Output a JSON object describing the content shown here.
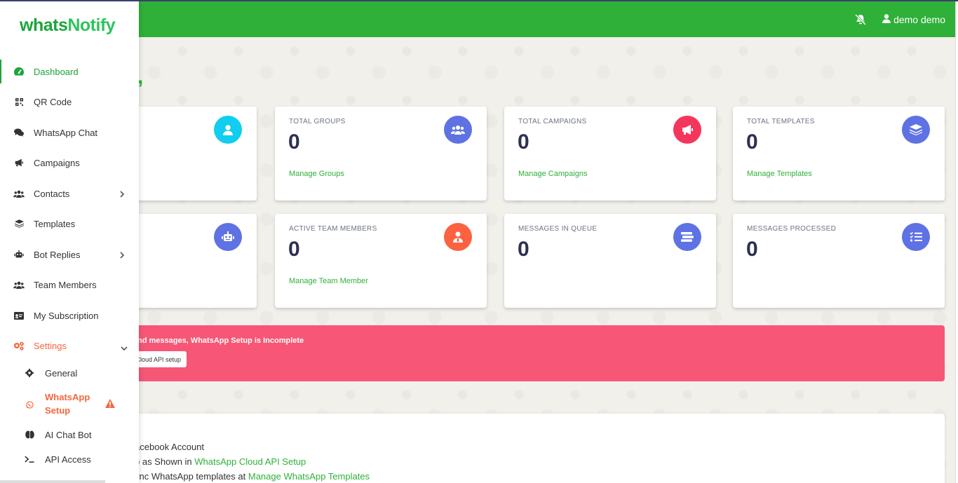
{
  "app": {
    "logo_part1": "whats",
    "logo_part2": "Notify",
    "brand_color": "#2eb039"
  },
  "header": {
    "user_label": "demo demo",
    "icons": [
      "bell-slash-icon",
      "user-icon"
    ]
  },
  "greeting_fragment": ",",
  "sidebar": {
    "items": [
      {
        "label": "Dashboard",
        "icon": "gauge-icon"
      },
      {
        "label": "QR Code",
        "icon": "qrcode-icon"
      },
      {
        "label": "WhatsApp Chat",
        "icon": "comments-icon"
      },
      {
        "label": "Campaigns",
        "icon": "megaphone-icon"
      },
      {
        "label": "Contacts",
        "icon": "users-icon"
      },
      {
        "label": "Templates",
        "icon": "layers-icon"
      },
      {
        "label": "Bot Replies",
        "icon": "robot-icon"
      },
      {
        "label": "Team Members",
        "icon": "users-icon"
      },
      {
        "label": "My Subscription",
        "icon": "id-card-icon"
      },
      {
        "label": "Settings",
        "icon": "cogs-icon"
      }
    ],
    "settings_sub": [
      {
        "label": "General",
        "icon": "gear-icon"
      },
      {
        "label": "WhatsApp Setup",
        "icon": "whatsapp-icon"
      },
      {
        "label": "AI Chat Bot",
        "icon": "brain-icon"
      },
      {
        "label": "API Access",
        "icon": "terminal-icon"
      }
    ]
  },
  "cards": [
    {
      "title": "",
      "value": "",
      "link": "",
      "icon_color": "#11cdef"
    },
    {
      "title": "TOTAL GROUPS",
      "value": "0",
      "link": "Manage Groups",
      "icon_color": "#5e72e4"
    },
    {
      "title": "TOTAL CAMPAIGNS",
      "value": "0",
      "link": "Manage Campaigns",
      "icon_color": "#f5365c"
    },
    {
      "title": "TOTAL TEMPLATES",
      "value": "0",
      "link": "Manage Templates",
      "icon_color": "#5e72e4"
    },
    {
      "title": "",
      "value": "",
      "link": "",
      "icon_color": "#5e72e4"
    },
    {
      "title": "ACTIVE TEAM MEMBERS",
      "value": "0",
      "link": "Manage Team Member",
      "icon_color": "#fb6340"
    },
    {
      "title": "MESSAGES IN QUEUE",
      "value": "0",
      "link": "",
      "icon_color": "#5e72e4"
    },
    {
      "title": "MESSAGES PROCESSED",
      "value": "0",
      "link": "",
      "icon_color": "#5e72e4"
    }
  ],
  "alert": {
    "text": "nd messages, WhatsApp Setup is Incomplete",
    "button": "p Cloud API setup",
    "color": "#f75676"
  },
  "info": {
    "line1": "acebook Account",
    "line2_prefix": "p as Shown in ",
    "line2_link": "WhatsApp Cloud API Setup",
    "line3_prefix": "ync WhatsApp templates at ",
    "line3_link": "Manage WhatsApp Templates"
  }
}
